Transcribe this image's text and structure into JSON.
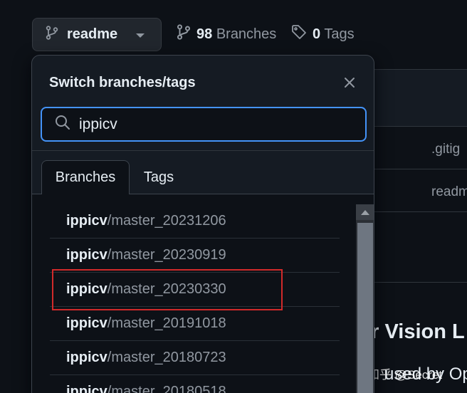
{
  "header": {
    "branch_button_label": "readme",
    "branches_count": "98",
    "branches_label": "Branches",
    "tags_count": "0",
    "tags_label": "Tags"
  },
  "background": {
    "file_1": ".gitig",
    "file_2": "readm",
    "heading": "er Vision L",
    "subtext": "used by Op",
    "watermark": "知乎 @Secret"
  },
  "dropdown": {
    "title": "Switch branches/tags",
    "search_value": "ippicv",
    "tabs": [
      {
        "label": "Branches",
        "active": true
      },
      {
        "label": "Tags",
        "active": false
      }
    ],
    "items": [
      {
        "prefix": "ippicv",
        "suffix": "/master_20231206"
      },
      {
        "prefix": "ippicv",
        "suffix": "/master_20230919"
      },
      {
        "prefix": "ippicv",
        "suffix": "/master_20230330"
      },
      {
        "prefix": "ippicv",
        "suffix": "/master_20191018"
      },
      {
        "prefix": "ippicv",
        "suffix": "/master_20180723"
      },
      {
        "prefix": "ippicv",
        "suffix": "/master_20180518"
      }
    ]
  },
  "colors": {
    "background": "#0d1117",
    "accent_focus": "#4493f8",
    "highlight_box": "#d12a2a",
    "muted_text": "#9198a1"
  },
  "icons": {
    "branch": "git-branch-icon",
    "tag": "tag-icon",
    "close": "close-icon",
    "search": "search-icon"
  }
}
